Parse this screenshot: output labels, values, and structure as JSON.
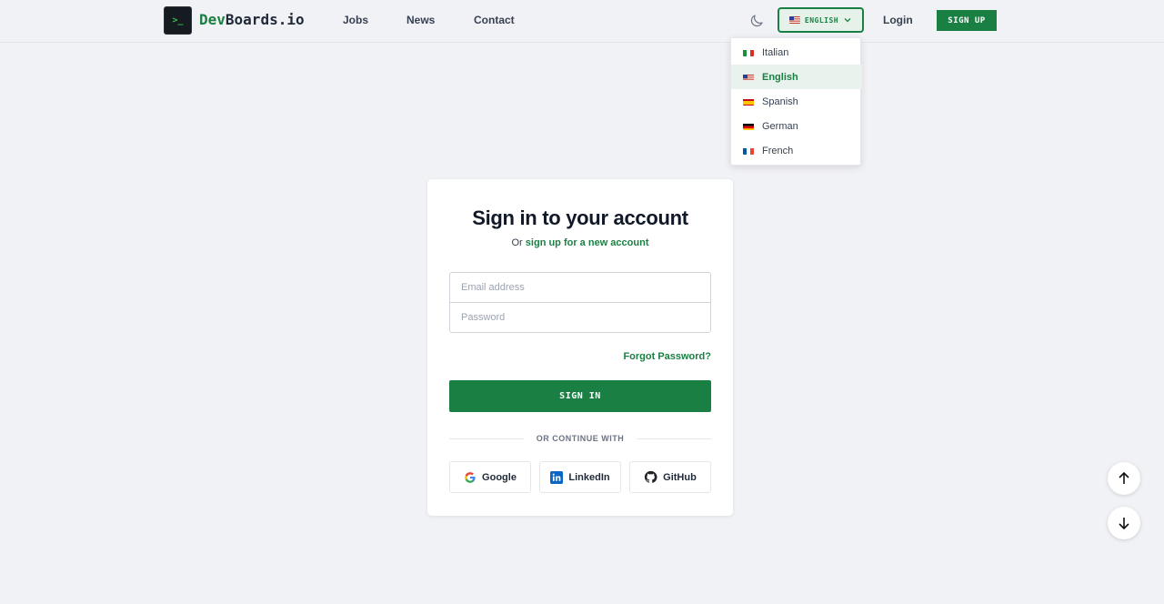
{
  "header": {
    "logo_glyph": ">_",
    "logo_prefix": "Dev",
    "logo_suffix": "Boards.io",
    "nav": [
      "Jobs",
      "News",
      "Contact"
    ],
    "language_button": "ENGLISH",
    "login": "Login",
    "signup": "SIGN UP"
  },
  "language_menu": {
    "items": [
      {
        "label": "Italian",
        "flag": "it-flag-icon"
      },
      {
        "label": "English",
        "flag": "us-flag-icon",
        "selected": true
      },
      {
        "label": "Spanish",
        "flag": "es-flag-icon"
      },
      {
        "label": "German",
        "flag": "de-flag-icon"
      },
      {
        "label": "French",
        "flag": "fr-flag-icon"
      }
    ]
  },
  "signin": {
    "title": "Sign in to your account",
    "subtitle_prefix": "Or",
    "subtitle_link": "sign up for a new account",
    "email_placeholder": "Email address",
    "password_placeholder": "Password",
    "forgot": "Forgot Password?",
    "submit": "SIGN IN",
    "divider": "OR CONTINUE WITH",
    "social": [
      "Google",
      "LinkedIn",
      "GitHub"
    ]
  },
  "colors": {
    "accent": "#1a7f43",
    "background": "#f1f2f6"
  },
  "icons": {
    "theme_toggle": "moon-icon",
    "language_chevron": "chevron-down-icon",
    "scroll_up": "arrow-up-icon",
    "scroll_down": "arrow-down-icon"
  }
}
